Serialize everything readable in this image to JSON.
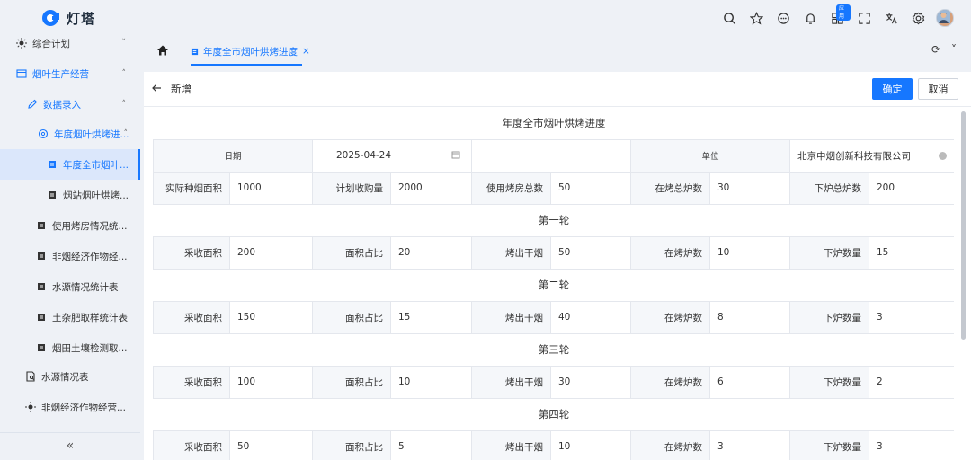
{
  "app": {
    "name": "灯塔"
  },
  "header": {
    "icons": [
      "search-icon",
      "star-icon",
      "chat-icon",
      "bell-icon",
      "apps-icon",
      "fullscreen-icon",
      "translate-icon",
      "gear-icon",
      "avatar"
    ],
    "apps_badge": "应用"
  },
  "sidebar": {
    "items": [
      {
        "label": "综合计划",
        "icon": "sun-icon",
        "chevron": "˅"
      },
      {
        "label": "烟叶生产经营",
        "icon": "window-icon",
        "chevron": "˄"
      },
      {
        "label": "数据录入",
        "icon": "edit-icon",
        "chevron": "˄"
      },
      {
        "label": "年度烟叶烘烤进...",
        "icon": "settings-icon",
        "chevron": "˄"
      },
      {
        "label": "年度全市烟叶...",
        "icon": "doc-icon"
      },
      {
        "label": "烟站烟叶烘烤...",
        "icon": "doc-icon"
      },
      {
        "label": "使用烤房情况统...",
        "icon": "doc-icon"
      },
      {
        "label": "非烟经济作物经...",
        "icon": "doc-icon"
      },
      {
        "label": "水源情况统计表",
        "icon": "doc-icon"
      },
      {
        "label": "土杂肥取样统计表",
        "icon": "doc-icon"
      },
      {
        "label": "烟田土壤检测取...",
        "icon": "doc-icon"
      },
      {
        "label": "水源情况表",
        "icon": "file-search-icon"
      },
      {
        "label": "非烟经济作物经营...",
        "icon": "sun-icon"
      }
    ],
    "collapse": "«"
  },
  "tabs": {
    "active": "年度全市烟叶烘烤进度",
    "close": "×",
    "refresh": "⟳",
    "more": "˅"
  },
  "page": {
    "back_label": "新增",
    "ok_label": "确定",
    "cancel_label": "取消"
  },
  "form": {
    "title": "年度全市烟叶烘烤进度",
    "date_label": "日期",
    "date_value": "2025-04-24",
    "unit_label": "单位",
    "unit_value": "北京中烟创新科技有限公司",
    "summary": [
      {
        "label": "实际种烟面积",
        "value": "1000"
      },
      {
        "label": "计划收购量",
        "value": "2000"
      },
      {
        "label": "使用烤房总数",
        "value": "50"
      },
      {
        "label": "在烤总炉数",
        "value": "30"
      },
      {
        "label": "下炉总炉数",
        "value": "200"
      }
    ],
    "rounds": [
      {
        "name": "第一轮",
        "fields": [
          {
            "label": "采收面积",
            "value": "200"
          },
          {
            "label": "面积占比",
            "value": "20"
          },
          {
            "label": "烤出干烟",
            "value": "50"
          },
          {
            "label": "在烤炉数",
            "value": "10"
          },
          {
            "label": "下炉数量",
            "value": "15"
          }
        ]
      },
      {
        "name": "第二轮",
        "fields": [
          {
            "label": "采收面积",
            "value": "150"
          },
          {
            "label": "面积占比",
            "value": "15"
          },
          {
            "label": "烤出干烟",
            "value": "40"
          },
          {
            "label": "在烤炉数",
            "value": "8"
          },
          {
            "label": "下炉数量",
            "value": "3"
          }
        ]
      },
      {
        "name": "第三轮",
        "fields": [
          {
            "label": "采收面积",
            "value": "100"
          },
          {
            "label": "面积占比",
            "value": "10"
          },
          {
            "label": "烤出干烟",
            "value": "30"
          },
          {
            "label": "在烤炉数",
            "value": "6"
          },
          {
            "label": "下炉数量",
            "value": "2"
          }
        ]
      },
      {
        "name": "第四轮",
        "fields": [
          {
            "label": "采收面积",
            "value": "50"
          },
          {
            "label": "面积占比",
            "value": "5"
          },
          {
            "label": "烤出干烟",
            "value": "10"
          },
          {
            "label": "在烤炉数",
            "value": "3"
          },
          {
            "label": "下炉数量",
            "value": "3"
          }
        ]
      }
    ]
  },
  "colors": {
    "accent": "#1677ff",
    "label_bg": "#f5f7fa",
    "border": "#e4e7ed"
  }
}
